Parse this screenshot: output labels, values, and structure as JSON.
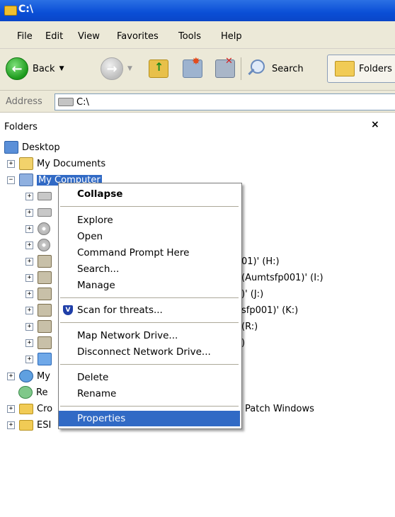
{
  "window": {
    "title": "C:\\"
  },
  "menu": [
    "File",
    "Edit",
    "View",
    "Favorites",
    "Tools",
    "Help"
  ],
  "toolbar": {
    "back_label": "Back",
    "search_label": "Search",
    "folders_label": "Folders"
  },
  "address": {
    "label": "Address",
    "value": "C:\\"
  },
  "folders_pane": {
    "title": "Folders",
    "close_glyph": "×"
  },
  "tree": {
    "desktop": "Desktop",
    "my_documents": "My Documents",
    "my_computer": "My Computer",
    "partial_h": "01)' (H:)",
    "partial_i": "(Aumtsfp001)' (I:)",
    "partial_j": ")' (J:)",
    "partial_k": "sfp001)' (K:)",
    "partial_r": "(R:)",
    "partial_paren": ")",
    "my_net_partial": "My",
    "recycle_partial": "Re",
    "cro_partial": "Cro",
    "esi_partial": "ESI",
    "patch_windows": "Patch Windows"
  },
  "context_menu": {
    "collapse": "Collapse",
    "explore": "Explore",
    "open": "Open",
    "command_prompt": "Command Prompt Here",
    "search": "Search...",
    "manage": "Manage",
    "scan": "Scan for threats...",
    "map_drive": "Map Network Drive...",
    "disconnect_drive": "Disconnect Network Drive...",
    "delete": "Delete",
    "rename": "Rename",
    "properties": "Properties"
  },
  "colors": {
    "titlebar": "#0a4ed6",
    "selection": "#316ac5",
    "chrome": "#ece9d8"
  }
}
